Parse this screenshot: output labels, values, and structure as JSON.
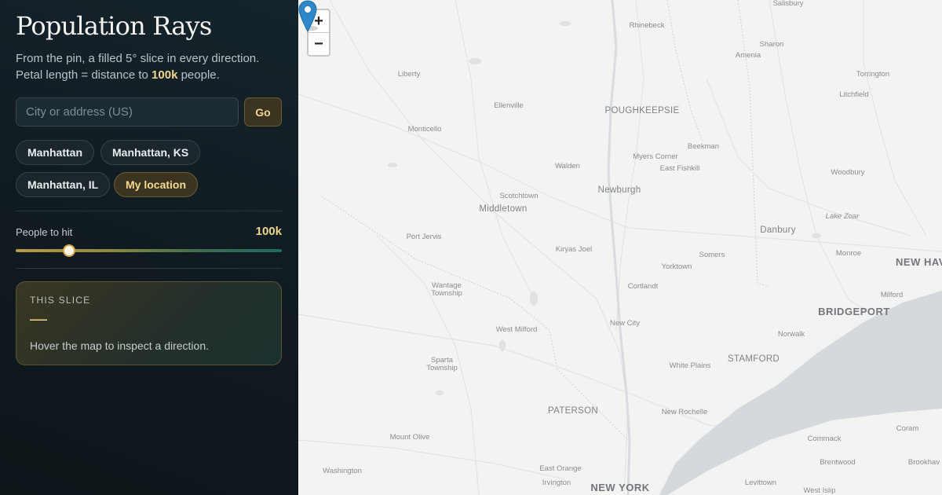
{
  "sidebar": {
    "title": "Population Rays",
    "subtitle_pre": "From the pin, a filled 5° slice in every direction.",
    "subtitle_line2_pre": "Petal length = distance to ",
    "subtitle_highlight": "100k",
    "subtitle_post": " people.",
    "search": {
      "placeholder": "City or address (US)",
      "value": ""
    },
    "go_label": "Go",
    "chips": [
      "Manhattan",
      "Manhattan, KS",
      "Manhattan, IL",
      "My location"
    ],
    "active_chip": "My location",
    "slider": {
      "label": "People to hit",
      "value_label": "100k",
      "fraction": 0.2
    },
    "slice": {
      "heading": "THIS SLICE",
      "value": "—",
      "hint": "Hover the map to inspect a direction."
    }
  },
  "map": {
    "zoom_in": "+",
    "zoom_out": "−",
    "places": [
      "Rhinebeck",
      "Salisbury",
      "Sharon",
      "Amenia",
      "Torrington",
      "Litchfield",
      "Liberty",
      "Ellenville",
      "POUGHKEEPSIE",
      "Monticello",
      "Beekman",
      "Myers Corner",
      "East Fishkill",
      "Walden",
      "Woodbury",
      "Newburgh",
      "Scotchtown",
      "Middletown",
      "Lake Zoar",
      "Danbury",
      "Port Jervis",
      "Kiryas Joel",
      "Somers",
      "Monroe",
      "Yorktown",
      "NEW HAV",
      "Wantage Township",
      "Cortlandt",
      "Milford",
      "BRIDGEPORT",
      "New City",
      "West Milford",
      "Norwalk",
      "White Plains",
      "STAMFORD",
      "Sparta Township",
      "PATERSON",
      "New Rochelle",
      "Mount Olive",
      "Commack",
      "Coram",
      "East Orange",
      "Brentwood",
      "Brookhav",
      "Washington",
      "Irvington",
      "Levittown",
      "NEW YORK",
      "West Islip"
    ],
    "water_color": "#d6d9dc",
    "pin_color": "#2f86c8"
  }
}
